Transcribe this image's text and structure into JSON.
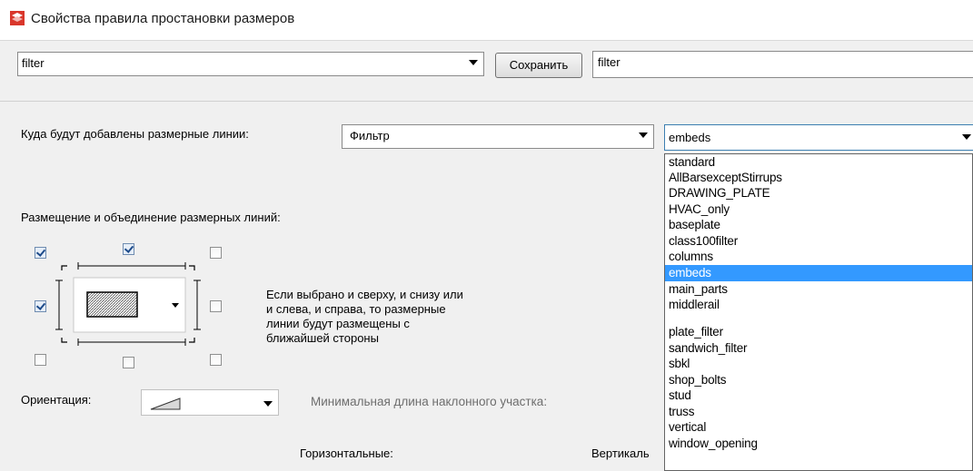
{
  "window": {
    "title": "Свойства правила простановки размеров"
  },
  "top": {
    "preset_value": "filter",
    "save_label": "Сохранить",
    "name_value": "filter"
  },
  "destination": {
    "label": "Куда будут добавлены размерные линии:",
    "type_value": "Фильтр",
    "filter_value": "embeds"
  },
  "placement": {
    "label": "Размещение и объединение размерных линий:",
    "note_lines": [
      "Если выбрано и сверху, и снизу или",
      "и слева, и справа, то размерные",
      "линии будут размещены с",
      "ближайшей стороны"
    ],
    "checkboxes": {
      "top_left": true,
      "top_mid": true,
      "top_right": false,
      "left": true,
      "right": false,
      "bottom_left": false,
      "bottom_mid": false,
      "bottom_right": false
    }
  },
  "orientation": {
    "label": "Ориентация:"
  },
  "slope": {
    "label": "Минимальная длина наклонного участка:"
  },
  "columns": {
    "horizontal": "Горизонтальные:",
    "vertical": "Вертикаль"
  },
  "filter_options": [
    "standard",
    "AllBarsexceptStirrups",
    "DRAWING_PLATE",
    "HVAC_only",
    "baseplate",
    "class100filter",
    "columns",
    "embeds",
    "main_parts",
    "middlerail",
    "",
    "plate_filter",
    "sandwich_filter",
    "sbkl",
    "shop_bolts",
    "stud",
    "truss",
    "vertical",
    "window_opening"
  ],
  "selected_option": "embeds"
}
